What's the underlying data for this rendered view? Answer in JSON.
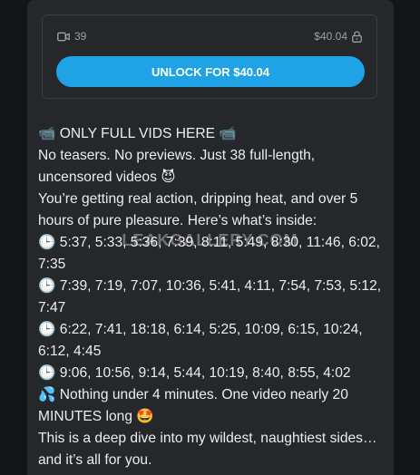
{
  "media": {
    "video_count": "39",
    "price": "$40.04",
    "video_icon": "video-camera-icon",
    "lock_icon": "lock-icon"
  },
  "unlock_button_label": "UNLOCK FOR $40.04",
  "post": {
    "lines": [
      {
        "emoji_before": "📹",
        "text": "ONLY FULL VIDS HERE",
        "emoji_after": "📹"
      },
      {
        "emoji_before": "",
        "text": "No teasers. No previews. Just 38 full-length,",
        "emoji_after": ""
      },
      {
        "emoji_before": "",
        "text": "uncensored videos",
        "emoji_after": "😈"
      },
      {
        "emoji_before": "",
        "text": "You’re getting real action, dripping heat, and over 5",
        "emoji_after": ""
      },
      {
        "emoji_before": "",
        "text": "hours of pure pleasure. Here’s what’s inside:",
        "emoji_after": ""
      },
      {
        "emoji_before": "🕒",
        "text": "5:37, 5:33, 5:36, 7:39, 8:11, 5:49, 8:30, 11:46, 6:02,",
        "emoji_after": ""
      },
      {
        "emoji_before": "",
        "text": "7:35",
        "emoji_after": ""
      },
      {
        "emoji_before": "🕒",
        "text": "7:39, 7:19, 7:07, 10:36, 5:41, 4:11, 7:54, 7:53, 5:12,",
        "emoji_after": ""
      },
      {
        "emoji_before": "",
        "text": "7:47",
        "emoji_after": ""
      },
      {
        "emoji_before": "🕒",
        "text": "6:22, 7:41, 18:18, 6:14, 5:25, 10:09, 6:15, 10:24,",
        "emoji_after": ""
      },
      {
        "emoji_before": "",
        "text": "6:12, 4:45",
        "emoji_after": ""
      },
      {
        "emoji_before": "🕒",
        "text": "9:06, 10:56, 9:14, 5:44, 10:19, 8:40, 8:55, 4:02",
        "emoji_after": ""
      },
      {
        "emoji_before": "💦",
        "text": "Nothing under 4 minutes. One video nearly 20",
        "emoji_after": ""
      },
      {
        "emoji_before": "",
        "text": "MINUTES long",
        "emoji_after": "🤩"
      },
      {
        "emoji_before": "",
        "text": "This is a deep dive into my wildest, naughtiest sides…",
        "emoji_after": ""
      },
      {
        "emoji_before": "",
        "text": "and it’s all for you.",
        "emoji_after": ""
      }
    ]
  },
  "watermark": "LEAKGALLERY.COM",
  "colors": {
    "accent": "#1fa3e6",
    "panel": "#25272a",
    "background": "#131517"
  }
}
